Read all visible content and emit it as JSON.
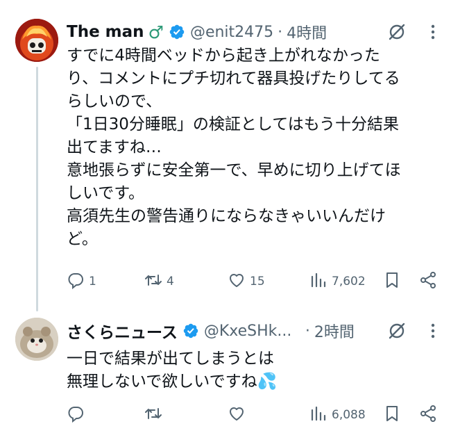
{
  "tweets": [
    {
      "name": "The man",
      "emoji": "♂",
      "handle": "@enit2475",
      "separator": "·",
      "time": "4時間",
      "lines": [
        "すでに4時間ベッドから起き上がれなかった",
        "り、コメントにプチ切れて器具投げたりしてる",
        "らしいので、",
        "「1日30分睡眠」の検証としてはもう十分結果",
        "出てますね…",
        "意地張らずに安全第一で、早めに切り上げてほ",
        "しいです。",
        "高須先生の警告通りにならなきゃいいんだけ",
        "ど。"
      ],
      "replies": "1",
      "retweets": "4",
      "likes": "15",
      "views": "7,602"
    },
    {
      "name": "さくらニュース",
      "handle": "@KxeSHk...",
      "separator": "·",
      "time": "2時間",
      "lines": [
        "一日で結果が出てしまうとは",
        "無理しないで欲しいですね💦"
      ],
      "replies": "",
      "retweets": "",
      "likes": "",
      "views": "6,088"
    }
  ],
  "colors": {
    "verified": "#1d9bf0",
    "secondary_text": "#536471",
    "primary_text": "#0f1419",
    "male_sign": "#2e9a78"
  },
  "icons": [
    "reply-icon",
    "retweet-icon",
    "like-icon",
    "views-icon",
    "bookmark-icon",
    "share-icon",
    "grok-icon",
    "more-icon",
    "verified-badge-icon"
  ]
}
